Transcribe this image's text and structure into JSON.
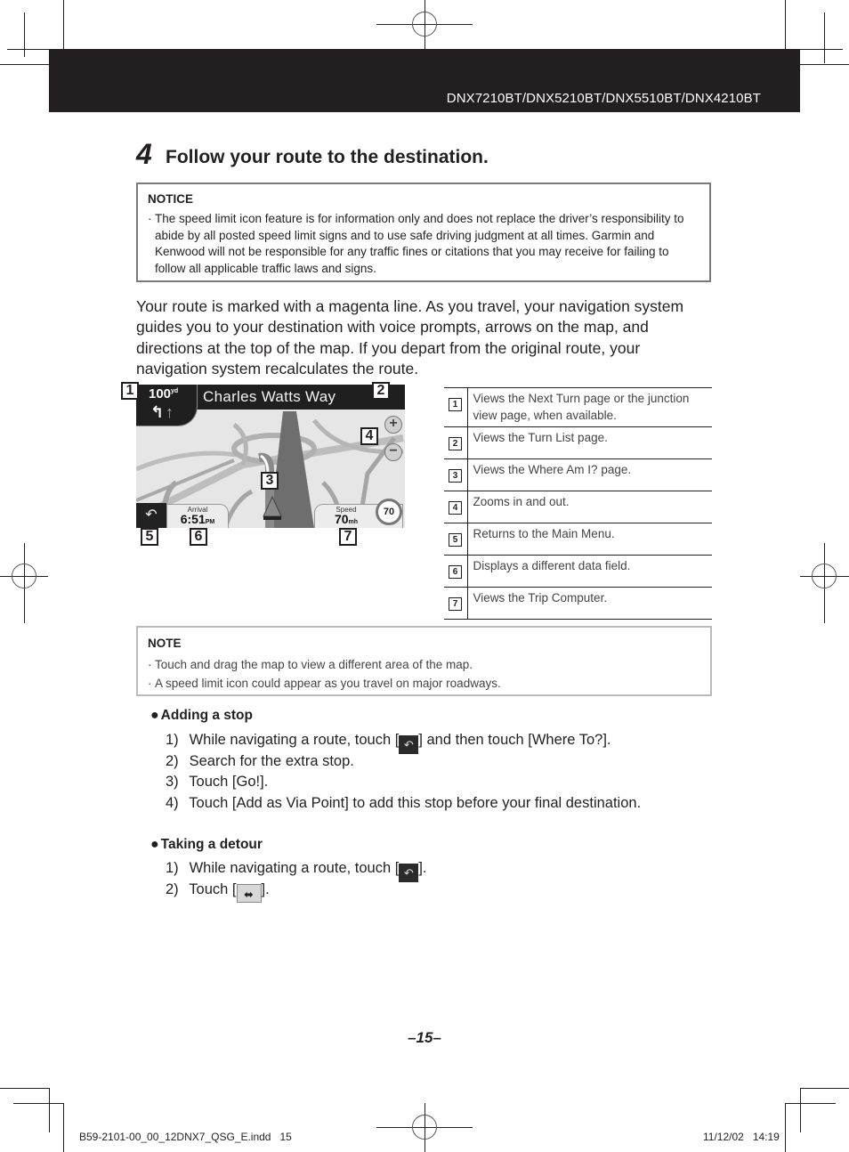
{
  "header": {
    "models": "DNX7210BT/DNX5210BT/DNX5510BT/DNX4210BT"
  },
  "step": {
    "number": "4",
    "title": "Follow your route to the destination."
  },
  "notice": {
    "heading": "NOTICE",
    "bullet": "·",
    "items": [
      "The speed limit icon feature is for information only and does not replace the driver’s responsibility to abide by all posted speed limit signs and to use safe driving judgment at all times. Garmin and Kenwood will not be responsible for any traffic fines or citations that you may receive for failing to follow all applicable traffic laws and signs."
    ]
  },
  "intro": "Your route is marked with a magenta line. As you travel, your navigation system guides you to your destination with voice prompts, arrows on the map, and directions at the top of the map. If you depart from the original route, your navigation system recalculates the route.",
  "map_screen": {
    "street_name": "Charles Watts Way",
    "turn_distance": "100",
    "turn_distance_unit": "yd",
    "zoom_in": "+",
    "zoom_out": "−",
    "menu_icon": "back-arrow-icon",
    "arrival_label": "Arrival",
    "arrival_time": "6:51",
    "arrival_suffix": "PM",
    "speed_label": "Speed",
    "speed_value": "70",
    "speed_unit": "mh",
    "speed_limit": "70",
    "callouts": [
      "1",
      "2",
      "3",
      "4",
      "5",
      "6",
      "7"
    ]
  },
  "legend": [
    {
      "num": "1",
      "text": "Views the Next Turn page or the junction view page, when available."
    },
    {
      "num": "2",
      "text": "Views the Turn List page."
    },
    {
      "num": "3",
      "text": "Views the Where Am I? page."
    },
    {
      "num": "4",
      "text": "Zooms in and out."
    },
    {
      "num": "5",
      "text": "Returns to the Main Menu."
    },
    {
      "num": "6",
      "text": "Displays a different data field."
    },
    {
      "num": "7",
      "text": "Views the Trip Computer."
    }
  ],
  "note": {
    "heading": "NOTE",
    "bullet": "·",
    "items": [
      "Touch and drag the map to view a different area of the map.",
      "A speed limit icon could appear as you travel on major roadways."
    ]
  },
  "procedures": [
    {
      "bullet": "●",
      "title": "Adding a stop",
      "steps": [
        {
          "n": "1)",
          "before": "While navigating a route, touch [",
          "icon": "back-arrow-icon",
          "after": "] and then touch [Where To?]."
        },
        {
          "n": "2)",
          "text": "Search for the extra stop."
        },
        {
          "n": "3)",
          "text": "Touch [Go!]."
        },
        {
          "n": "4)",
          "text": "Touch [Add as Via Point] to add this stop before your final destination."
        }
      ]
    },
    {
      "bullet": "●",
      "title": "Taking a detour",
      "steps": [
        {
          "n": "1)",
          "before": "While navigating a route, touch [",
          "icon": "back-arrow-icon",
          "after": "]."
        },
        {
          "n": "2)",
          "before": "Touch [",
          "icon": "detour-arrows-icon",
          "after": "]."
        }
      ]
    }
  ],
  "footer": {
    "page_number": "–15–",
    "file_name": "B59-2101-00_00_12DNX7_QSG_E.indd   15",
    "date": "11/12/02   14:19"
  }
}
